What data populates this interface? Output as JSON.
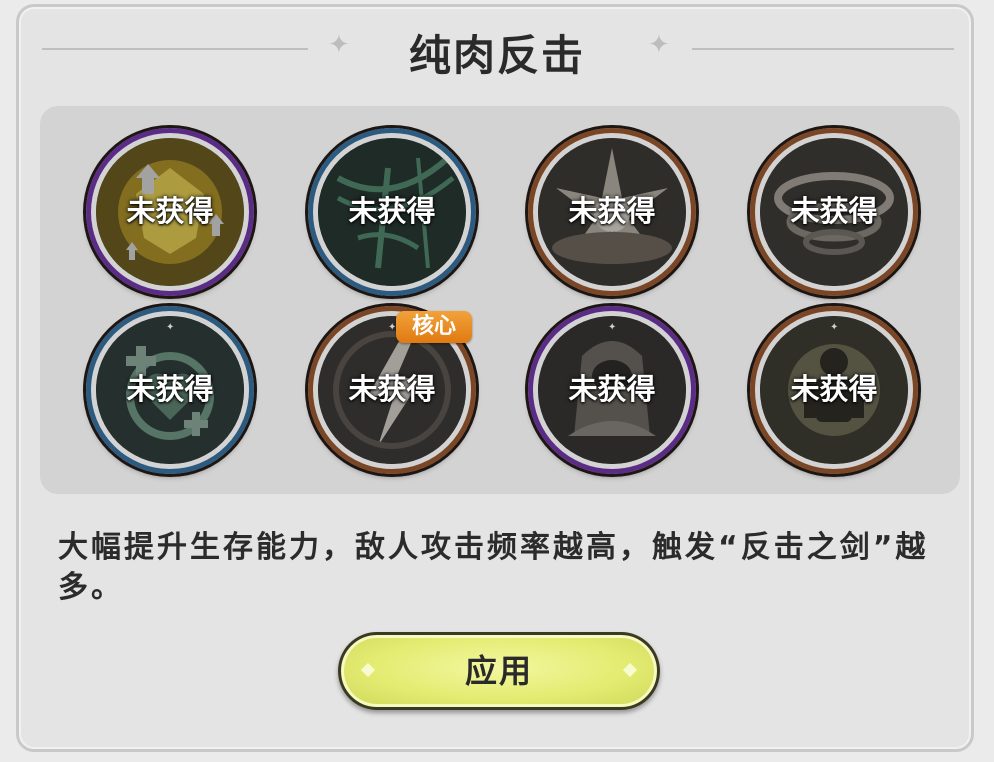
{
  "panel": {
    "title": "纯肉反击",
    "title_decoration_icon": "sparkle-icon",
    "skills": [
      {
        "label": "未获得",
        "frame": "purple",
        "art": "golden-crystal-upgrade"
      },
      {
        "label": "未获得",
        "frame": "blue",
        "art": "green-web-net"
      },
      {
        "label": "未获得",
        "frame": "bronze",
        "art": "explosion-burst"
      },
      {
        "label": "未获得",
        "frame": "bronze",
        "art": "tornado-swirl"
      },
      {
        "label": "未获得",
        "frame": "blue",
        "art": "healing-heart-cross"
      },
      {
        "label": "未获得",
        "frame": "bronze",
        "art": "lightning-strike",
        "badge": "核心"
      },
      {
        "label": "未获得",
        "frame": "purple",
        "art": "hooded-figure"
      },
      {
        "label": "未获得",
        "frame": "bronze",
        "art": "armored-warrior"
      }
    ],
    "description": "大幅提升生存能力，敌人攻击频率越高，触发“反击之剑”越多。",
    "apply_button": "应用"
  },
  "colors": {
    "frame_purple": "#5b2c86",
    "frame_blue": "#2d5a7f",
    "frame_bronze": "#7a4625",
    "badge_orange": "#e8891c",
    "button_yellow": "#e4ec72"
  }
}
